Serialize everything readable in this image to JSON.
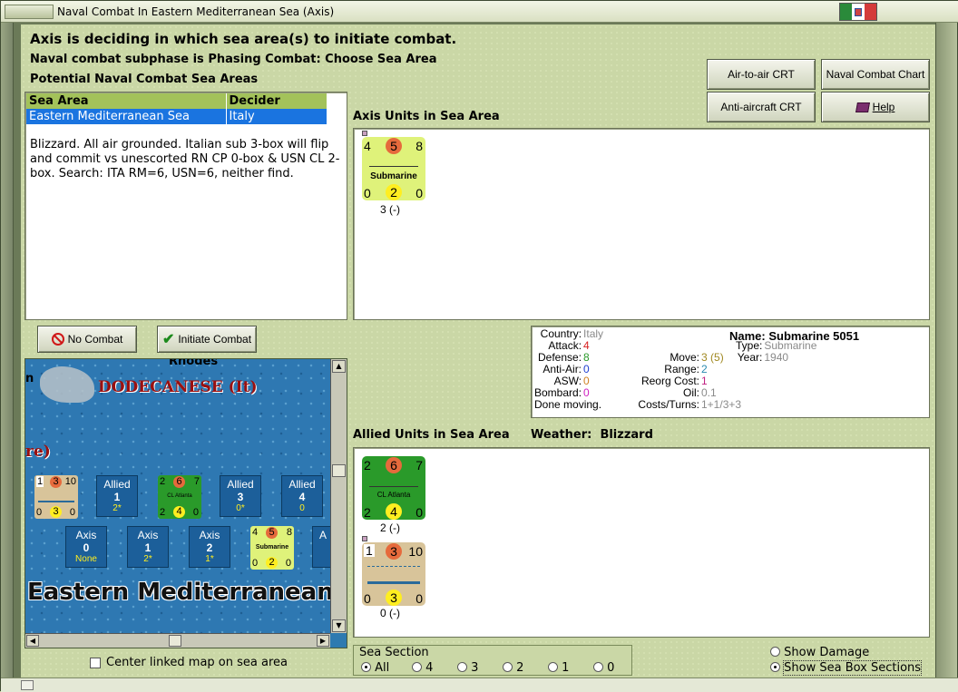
{
  "window": {
    "title": "Naval Combat In Eastern Mediterranean Sea (Axis)"
  },
  "header": {
    "line1": "Axis is deciding in which sea area(s) to initiate combat.",
    "line2": "Naval combat subphase is Phasing Combat: Choose Sea Area",
    "line3": "Potential Naval Combat Sea Areas"
  },
  "buttons": {
    "air_to_air": "Air-to-air CRT",
    "naval_chart": "Naval Combat Chart",
    "anti_aircraft": "Anti-aircraft CRT",
    "help": "Help",
    "no_combat": "No Combat",
    "initiate_combat": "Initiate Combat"
  },
  "sea_table": {
    "headers": [
      "Sea Area",
      "Decider"
    ],
    "rows": [
      {
        "area": "Eastern Mediterranean Sea",
        "decider": "Italy"
      }
    ]
  },
  "search_report": "Blizzard.  All air grounded.  Italian sub 3-box will flip and commit vs unescorted RN CP 0-box & USN CL 2-box.   Search:  ITA RM=6, USN=6, neither find.",
  "axis_units": {
    "label": "Axis Units in Sea Area",
    "units": [
      {
        "tl": "4",
        "tc": "5",
        "tr": "8",
        "name": "Submarine",
        "bl": "0",
        "bc": "2",
        "br": "0",
        "caption": "3 (-)",
        "color": "#dff27a"
      }
    ]
  },
  "unit_info": {
    "country_label": "Country:",
    "country": "Italy",
    "attack_label": "Attack:",
    "attack": "4",
    "defense_label": "Defense:",
    "defense": "8",
    "antiair_label": "Anti-Air:",
    "antiair": "0",
    "asw_label": "ASW:",
    "asw": "0",
    "bombard_label": "Bombard:",
    "bombard": "0",
    "status": "Done moving.",
    "name_label": "Name:",
    "name": "Submarine 5051",
    "move_label": "Move:",
    "move": "3",
    "move_extra": "(5)",
    "type_label": "Type:",
    "type": "Submarine",
    "range_label": "Range:",
    "range": "2",
    "year_label": "Year:",
    "year": "1940",
    "reorg_label": "Reorg Cost:",
    "reorg": "1",
    "oil_label": "Oil:",
    "oil": "0.1",
    "costs_label": "Costs/Turns:",
    "costs": "1+1/3+3"
  },
  "allied_units": {
    "label": "Allied Units in Sea Area",
    "weather_label": "Weather:",
    "weather": "Blizzard",
    "units": [
      {
        "tl": "2",
        "tc": "6",
        "tr": "7",
        "name": "CL Atlanta",
        "bl": "2",
        "bc": "4",
        "br": "0",
        "caption": "2 (-)",
        "color": "#2a9a2a"
      },
      {
        "tl": "1",
        "tc": "3",
        "tr": "10",
        "name": "",
        "bl": "0",
        "bc": "3",
        "br": "0",
        "caption": "0 (-)",
        "color": "#d8c49a"
      }
    ]
  },
  "map": {
    "label_rhodes": "Rhodes",
    "label_dodecanese": "DODECANESE (It)",
    "label_re": "re)",
    "label_n": "n",
    "sea_name": "Eastern Mediterranean",
    "allied_boxes": [
      {
        "t": "Allied",
        "v": "1",
        "s": "2*"
      },
      {
        "t": "Allied",
        "v": "3",
        "s": "0*"
      },
      {
        "t": "Allied",
        "v": "4",
        "s": "0"
      }
    ],
    "axis_boxes": [
      {
        "t": "Axis",
        "v": "0",
        "s": "None"
      },
      {
        "t": "Axis",
        "v": "1",
        "s": "2*"
      },
      {
        "t": "Axis",
        "v": "2",
        "s": "1*"
      },
      {
        "t": "A",
        "v": "",
        "s": ""
      }
    ],
    "mini_rn": {
      "tl": "1",
      "tc": "3",
      "tr": "10",
      "bl": "0",
      "bc": "3",
      "br": "0"
    },
    "mini_cl": {
      "tl": "2",
      "tc": "6",
      "tr": "7",
      "name": "CL Atlanta",
      "bl": "2",
      "bc": "4",
      "br": "0"
    },
    "mini_sub": {
      "tl": "4",
      "tc": "5",
      "tr": "8",
      "name": "Submarine",
      "bl": "0",
      "bc": "2",
      "br": "0"
    }
  },
  "center_map_label": "Center linked map on sea area",
  "sea_section": {
    "label": "Sea Section",
    "options": [
      "All",
      "4",
      "3",
      "2",
      "1",
      "0"
    ],
    "selected": "All"
  },
  "show_damage": "Show Damage",
  "show_sea_box": "Show Sea Box Sections",
  "colors": {
    "accent_red": "#e66a3c",
    "selection_blue": "#1a74e0"
  }
}
